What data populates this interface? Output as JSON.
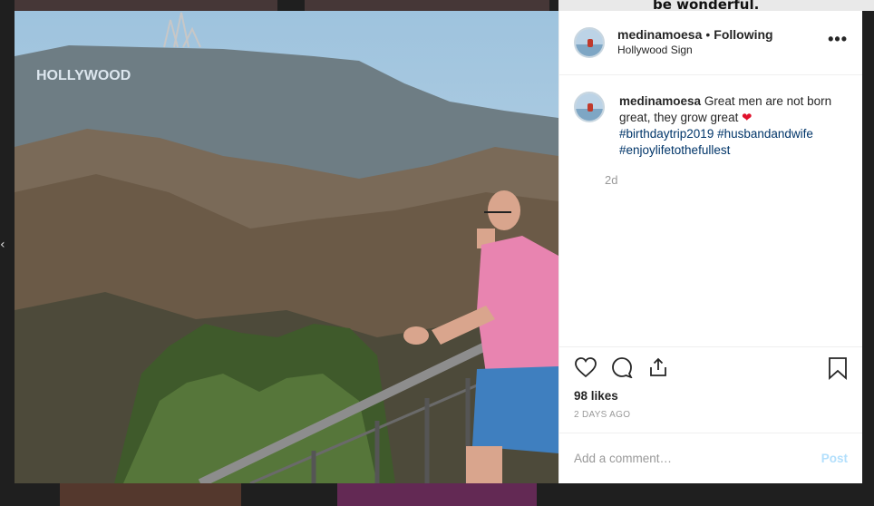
{
  "background": {
    "snippet": "be wonderful."
  },
  "post": {
    "username": "medinamoesa",
    "separator": "•",
    "follow_status": "Following",
    "location": "Hollywood Sign",
    "caption_text": "Great men are not born great, they grow great",
    "caption_emoji": "❤",
    "hashtags": [
      "#birthdaytrip2019",
      "#husbandandwife",
      "#enjoylifetothefullest"
    ],
    "relative_time": "2d",
    "likes": "98 likes",
    "date": "2 DAYS AGO",
    "photo_sign": "HOLLYWOOD"
  },
  "comment_box": {
    "placeholder": "Add a comment…",
    "post_label": "Post"
  },
  "icons": [
    "heart-icon",
    "comment-icon",
    "share-icon",
    "bookmark-icon",
    "more-options-icon"
  ],
  "colors": {
    "link": "#003569",
    "post_disabled": "#b2dffc",
    "heart": "#e0112b"
  }
}
